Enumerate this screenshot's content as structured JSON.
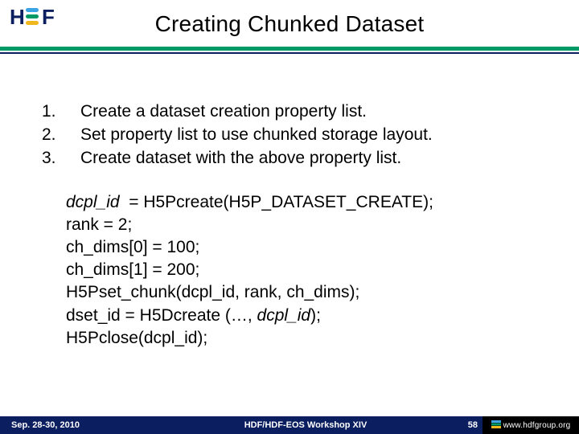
{
  "header": {
    "title": "Creating Chunked Dataset"
  },
  "steps": [
    {
      "n": "1.",
      "text": "Create a dataset creation property list."
    },
    {
      "n": "2.",
      "text": "Set property list to use chunked storage layout."
    },
    {
      "n": "3.",
      "text": "Create dataset with the above property list."
    }
  ],
  "code": {
    "l1a": "dcpl_id",
    "l1b": "= H5Pcreate(H5P_DATASET_CREATE);",
    "l2": "rank = 2;",
    "l3": "ch_dims[0] = 100;",
    "l4": "ch_dims[1] = 200;",
    "l5": "H5Pset_chunk(dcpl_id, rank, ch_dims);",
    "l6a": "dset_id = H5Dcreate (…, ",
    "l6b": "dcpl_id",
    "l6c": ");",
    "l7": "H5Pclose(dcpl_id);"
  },
  "footer": {
    "date": "Sep. 28-30, 2010",
    "workshop": "HDF/HDF-EOS Workshop XIV",
    "page": "58",
    "brand": "www.hdfgroup.org"
  }
}
